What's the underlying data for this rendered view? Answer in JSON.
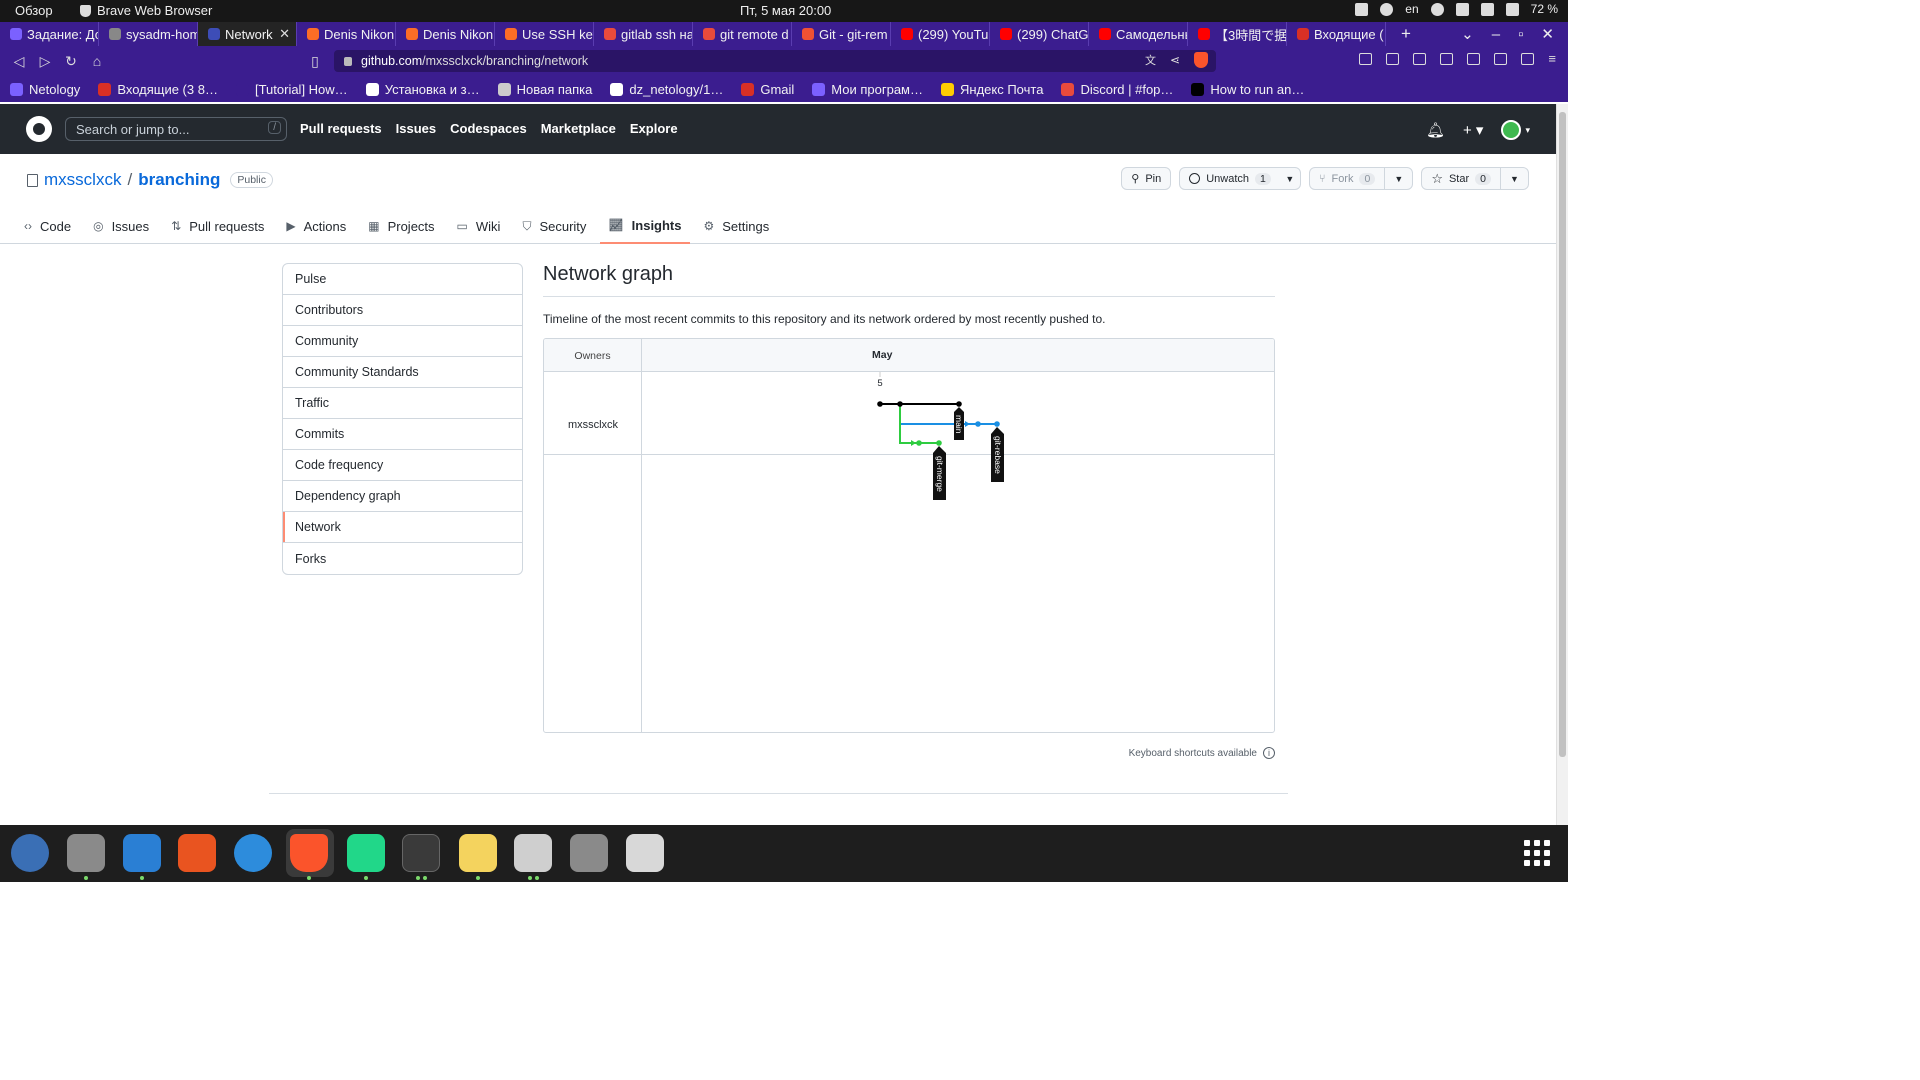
{
  "os": {
    "overview": "Обзор",
    "app_name": "Brave Web Browser",
    "clock": "Пт, 5 мая  20:00",
    "lang": "en",
    "battery": "72 %"
  },
  "tabs": [
    {
      "label": "Задание: До",
      "color": "#7b61ff"
    },
    {
      "label": "sysadm-hom",
      "color": "#888888"
    },
    {
      "label": "Network",
      "color": "#3d4db7",
      "active": true
    },
    {
      "label": "Denis Nikon",
      "color": "#fc6d26"
    },
    {
      "label": "Denis Nikon",
      "color": "#fc6d26"
    },
    {
      "label": "Use SSH keys",
      "color": "#fc6d26"
    },
    {
      "label": "gitlab ssh на",
      "color": "#e94b3c"
    },
    {
      "label": "git remote d",
      "color": "#e94b3c"
    },
    {
      "label": "Git - git-rem",
      "color": "#f05133"
    },
    {
      "label": "(299) YouTu",
      "color": "#ff0000"
    },
    {
      "label": "(299) ChatG",
      "color": "#ff0000"
    },
    {
      "label": "Самодельны",
      "color": "#ff0000"
    },
    {
      "label": "【3時間で据",
      "color": "#ff0000"
    },
    {
      "label": "Входящие (",
      "color": "#d93025"
    }
  ],
  "toolbar": {
    "url_host": "github.com",
    "url_path": "/mxssclxck/branching/network"
  },
  "bookmarks": [
    {
      "label": "Netology",
      "color": "#7b61ff"
    },
    {
      "label": "Входящие (3 8…",
      "color": "#d93025"
    },
    {
      "label": "[Tutorial] How…",
      "color": "#3b1d8f"
    },
    {
      "label": "Установка и з…",
      "color": "#ffffff"
    },
    {
      "label": "Новая папка",
      "color": "#cccccc"
    },
    {
      "label": "dz_netology/1…",
      "color": "#ffffff"
    },
    {
      "label": "Gmail",
      "color": "#d93025"
    },
    {
      "label": "Мои програм…",
      "color": "#7b61ff"
    },
    {
      "label": "Яндекс Почта",
      "color": "#ffcc00"
    },
    {
      "label": "Discord | #fop…",
      "color": "#e94b3c"
    },
    {
      "label": "How to run an…",
      "color": "#000000"
    }
  ],
  "github": {
    "search_placeholder": "Search or jump to...",
    "search_key": "/",
    "nav": [
      "Pull requests",
      "Issues",
      "Codespaces",
      "Marketplace",
      "Explore"
    ]
  },
  "repo": {
    "owner": "mxssclxck",
    "sep": "/",
    "name": "branching",
    "visibility": "Public",
    "pin": "Pin",
    "unwatch": "Unwatch",
    "unwatch_count": "1",
    "fork": "Fork",
    "fork_count": "0",
    "star": "Star",
    "star_count": "0",
    "tabs": [
      "Code",
      "Issues",
      "Pull requests",
      "Actions",
      "Projects",
      "Wiki",
      "Security",
      "Insights",
      "Settings"
    ],
    "selected_tab": "Insights"
  },
  "sidebar": {
    "items": [
      "Pulse",
      "Contributors",
      "Community",
      "Community Standards",
      "Traffic",
      "Commits",
      "Code frequency",
      "Dependency graph",
      "Network",
      "Forks"
    ],
    "selected": "Network"
  },
  "main": {
    "title": "Network graph",
    "description": "Timeline of the most recent commits to this repository and its network ordered by most recently pushed to.",
    "owners_header": "Owners",
    "month": "May",
    "day": "5",
    "owner": "mxssclxck",
    "shortcuts": "Keyboard shortcuts available",
    "branches": [
      {
        "name": "main",
        "color": "#000000"
      },
      {
        "name": "git-merge",
        "color": "#2ecc40"
      },
      {
        "name": "git-rebase",
        "color": "#1a8fe3"
      }
    ]
  }
}
